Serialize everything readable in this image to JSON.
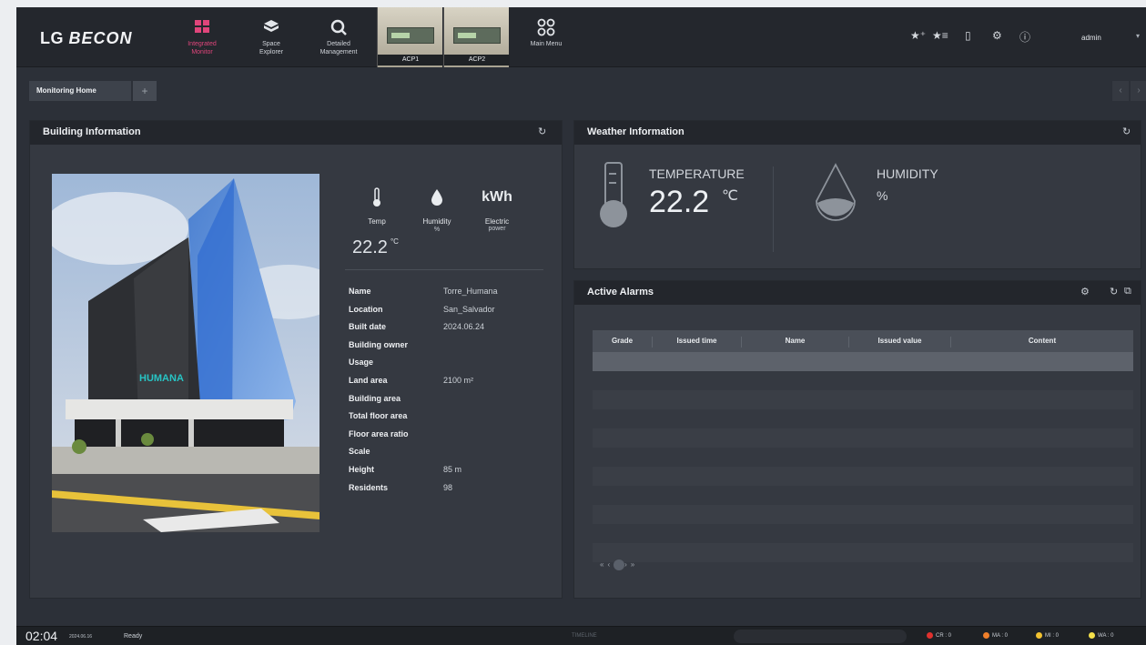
{
  "app": {
    "logo_prefix": "LG",
    "logo_name": "BECON",
    "admin_label": "admin"
  },
  "nav": [
    {
      "label_line1": "Integrated",
      "label_line2": "Monitor",
      "icon": "integrated-monitor-icon",
      "active": true
    },
    {
      "label_line1": "Space",
      "label_line2": "Explorer",
      "icon": "space-explorer-icon",
      "active": false
    },
    {
      "label_line1": "Detailed",
      "label_line2": "Management",
      "icon": "detailed-management-icon",
      "active": false
    }
  ],
  "devices": [
    {
      "label": "ACP1"
    },
    {
      "label": "ACP2"
    }
  ],
  "main_menu": {
    "label": "Main Menu",
    "icon": "main-menu-icon"
  },
  "tabs": {
    "active_label": "Monitoring Home",
    "add_label": "+"
  },
  "building": {
    "title": "Building Information",
    "temp_label": "Temp",
    "humidity_label": "Humidity",
    "humidity_unit": "%",
    "power_icon_text": "kWh",
    "power_label_line1": "Electric",
    "power_label_line2": "power",
    "temp_value": "22.2",
    "temp_unit": "°C",
    "sign_text": "HUMANA",
    "rows": [
      {
        "key": "Name",
        "value": "Torre_Humana"
      },
      {
        "key": "Location",
        "value": "San_Salvador"
      },
      {
        "key": "Built date",
        "value": "2024.06.24"
      },
      {
        "key": "Building owner",
        "value": ""
      },
      {
        "key": "Usage",
        "value": ""
      },
      {
        "key": "Land area",
        "value": "2100 m²"
      },
      {
        "key": "Building area",
        "value": ""
      },
      {
        "key": "Total floor area",
        "value": ""
      },
      {
        "key": "Floor area ratio",
        "value": ""
      },
      {
        "key": "Scale",
        "value": ""
      },
      {
        "key": "Height",
        "value": "85 m"
      },
      {
        "key": "Residents",
        "value": "98"
      }
    ]
  },
  "weather": {
    "title": "Weather Information",
    "temperature_label": "TEMPERATURE",
    "temperature_value": "22.2",
    "temperature_unit": "℃",
    "humidity_label": "HUMIDITY",
    "humidity_value": "%"
  },
  "alarms": {
    "title": "Active Alarms",
    "columns": [
      "Grade",
      "Issued time",
      "Name",
      "Issued value",
      "Content"
    ]
  },
  "status": {
    "time": "02:04",
    "date": "2024.06.16",
    "state": "Ready",
    "timeline_label": "TIMELINE",
    "counters": [
      {
        "label": "CR : 0",
        "color": "#e0312e"
      },
      {
        "label": "MA : 0",
        "color": "#f07f2a"
      },
      {
        "label": "MI : 0",
        "color": "#f2c230"
      },
      {
        "label": "WA : 0",
        "color": "#f4e04a"
      }
    ]
  },
  "colors": {
    "accent": "#e0457b",
    "panel": "#353941",
    "header": "#23262c",
    "background": "#2c3038"
  }
}
